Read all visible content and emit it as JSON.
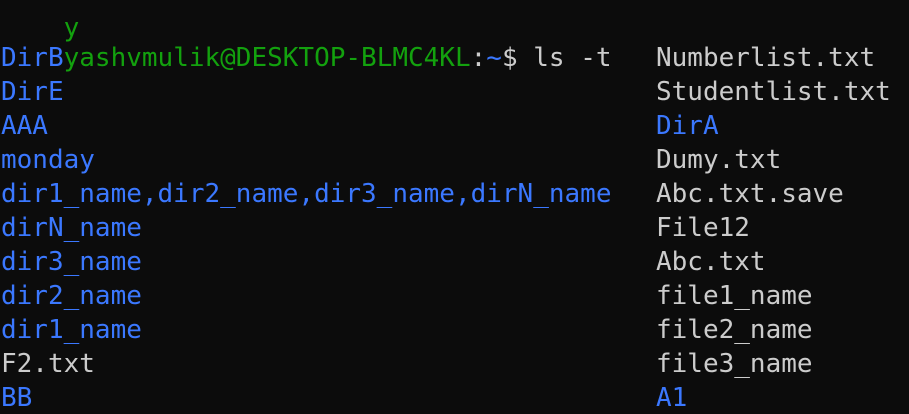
{
  "colors": {
    "background": "#0c0c0c",
    "prompt_user": "#13a10e",
    "prompt_path": "#3b78ff",
    "directory": "#3b78ff",
    "file": "#cccccc"
  },
  "prompt": {
    "clipped_text": "y",
    "user_host": "yashvmulik@DESKTOP-BLMC4KL",
    "separator": ":",
    "path": "~",
    "symbol": "$",
    "command": " ls -t"
  },
  "listing": [
    {
      "left": {
        "name": "DirB",
        "type": "dir"
      },
      "right": {
        "name": "Numberlist.txt",
        "type": "file"
      }
    },
    {
      "left": {
        "name": "DirE",
        "type": "dir"
      },
      "right": {
        "name": "Studentlist.txt",
        "type": "file"
      }
    },
    {
      "left": {
        "name": "AAA",
        "type": "dir"
      },
      "right": {
        "name": "DirA",
        "type": "dir"
      }
    },
    {
      "left": {
        "name": "monday",
        "type": "dir"
      },
      "right": {
        "name": "Dumy.txt",
        "type": "file"
      }
    },
    {
      "left": {
        "name": "dir1_name,dir2_name,dir3_name,dirN_name",
        "type": "dir"
      },
      "right": {
        "name": "Abc.txt.save",
        "type": "file"
      }
    },
    {
      "left": {
        "name": "dirN_name",
        "type": "dir"
      },
      "right": {
        "name": "File12",
        "type": "file"
      }
    },
    {
      "left": {
        "name": "dir3_name",
        "type": "dir"
      },
      "right": {
        "name": "Abc.txt",
        "type": "file"
      }
    },
    {
      "left": {
        "name": "dir2_name",
        "type": "dir"
      },
      "right": {
        "name": "file1_name",
        "type": "file"
      }
    },
    {
      "left": {
        "name": "dir1_name",
        "type": "dir"
      },
      "right": {
        "name": "file2_name",
        "type": "file"
      }
    },
    {
      "left": {
        "name": "F2.txt",
        "type": "file"
      },
      "right": {
        "name": "file3_name",
        "type": "file"
      }
    },
    {
      "left": {
        "name": "BB",
        "type": "dir"
      },
      "right": {
        "name": "A1",
        "type": "dir"
      }
    }
  ]
}
